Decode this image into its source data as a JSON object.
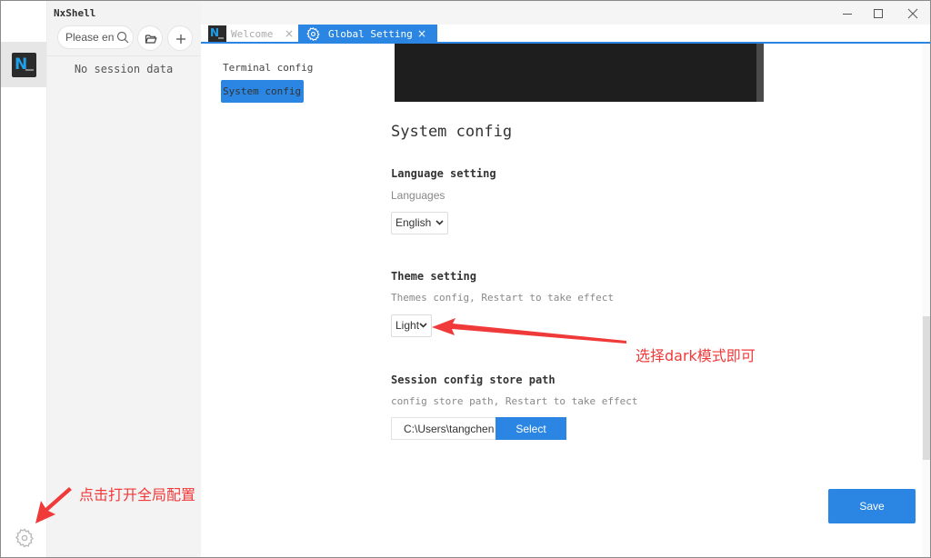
{
  "app": {
    "title": "NxShell"
  },
  "window_controls": {
    "minimize": "minimize",
    "maximize": "maximize",
    "close": "close"
  },
  "sidebar": {
    "search_placeholder": "Please enter",
    "empty_text": "No session data",
    "icons": [
      "search-icon",
      "folder-open-icon",
      "plus-icon"
    ]
  },
  "activity_bar": {
    "logo_text": "N",
    "settings_icon": "gear-icon"
  },
  "tabs": [
    {
      "label": "Welcome",
      "active": false,
      "icon": "nxshell-logo",
      "close": "×"
    },
    {
      "label": "Global Setting",
      "active": true,
      "icon": "gear-icon",
      "close": "×"
    }
  ],
  "config_nav": {
    "items": [
      {
        "label": "Terminal config",
        "active": false
      },
      {
        "label": "System config",
        "active": true
      }
    ]
  },
  "system_config": {
    "title": "System config",
    "language": {
      "title": "Language setting",
      "description": "Languages",
      "value": "English"
    },
    "theme": {
      "title": "Theme setting",
      "description": "Themes config, Restart to take effect",
      "value": "Light"
    },
    "store_path": {
      "title": "Session config store path",
      "description": "config store path, Restart to take effect",
      "value": "C:\\Users\\tangchen",
      "button": "Select"
    },
    "save_button": "Save"
  },
  "annotations": {
    "theme_hint": "选择dark模式即可",
    "gear_hint": "点击打开全局配置"
  },
  "colors": {
    "accent": "#2b86e3",
    "annotation": "#f03a3a",
    "terminal_bg": "#1e1e1e",
    "logo_blue": "#1ea0ea"
  }
}
